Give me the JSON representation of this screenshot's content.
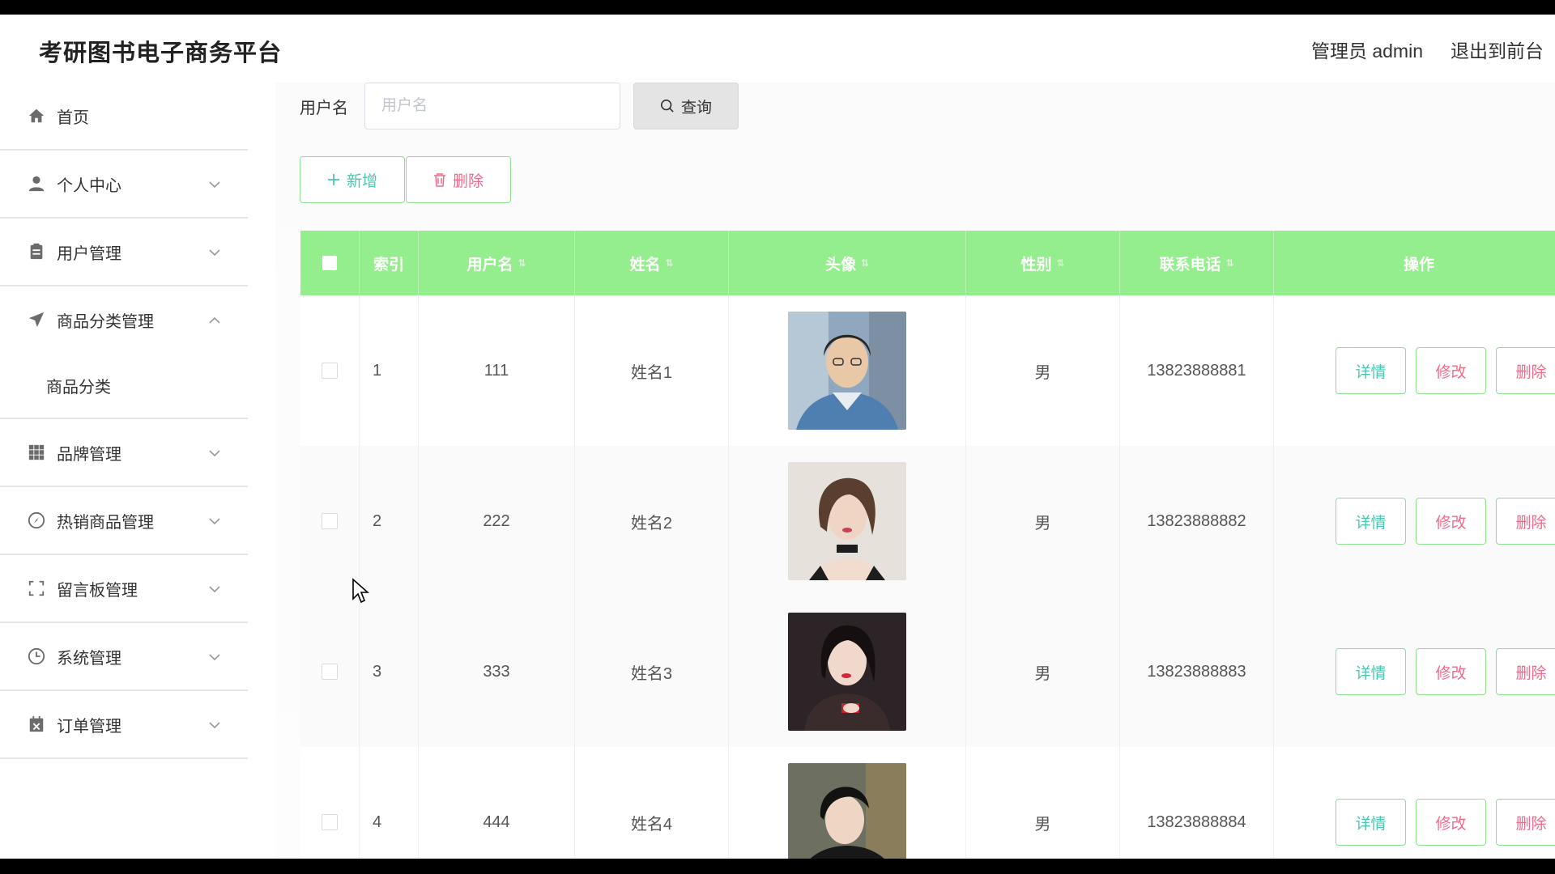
{
  "header": {
    "app_title": "考研图书电子商务平台",
    "admin_label": "管理员 admin",
    "exit_label": "退出到前台"
  },
  "sidebar": {
    "items": [
      {
        "label": "首页",
        "icon": "home-icon"
      },
      {
        "label": "个人中心",
        "icon": "user-icon"
      },
      {
        "label": "用户管理",
        "icon": "clipboard-icon"
      },
      {
        "label": "商品分类管理",
        "icon": "paper-plane-icon",
        "expanded": true,
        "children": [
          {
            "label": "商品分类"
          }
        ]
      },
      {
        "label": "品牌管理",
        "icon": "grid-icon"
      },
      {
        "label": "热销商品管理",
        "icon": "compass-icon"
      },
      {
        "label": "留言板管理",
        "icon": "fullscreen-icon"
      },
      {
        "label": "系统管理",
        "icon": "clock-icon"
      },
      {
        "label": "订单管理",
        "icon": "calendar-x-icon"
      }
    ]
  },
  "search": {
    "label": "用户名",
    "placeholder": "用户名",
    "value": "",
    "button_label": "查询"
  },
  "toolbar": {
    "add_label": "新增",
    "delete_label": "删除"
  },
  "colors": {
    "table_header": "#95ee8d",
    "accent_teal": "#4cc6b0",
    "accent_pink": "#f06b8a",
    "button_border": "#8ee08e"
  },
  "table": {
    "columns": [
      "索引",
      "用户名",
      "姓名",
      "头像",
      "性别",
      "联系电话",
      "操作"
    ],
    "rows": [
      {
        "index": "1",
        "username": "111",
        "name": "姓名1",
        "gender": "男",
        "phone": "13823888881"
      },
      {
        "index": "2",
        "username": "222",
        "name": "姓名2",
        "gender": "男",
        "phone": "13823888882"
      },
      {
        "index": "3",
        "username": "333",
        "name": "姓名3",
        "gender": "男",
        "phone": "13823888883"
      },
      {
        "index": "4",
        "username": "444",
        "name": "姓名4",
        "gender": "男",
        "phone": "13823888884"
      }
    ],
    "actions": {
      "detail": "详情",
      "edit": "修改",
      "delete": "删除"
    }
  }
}
